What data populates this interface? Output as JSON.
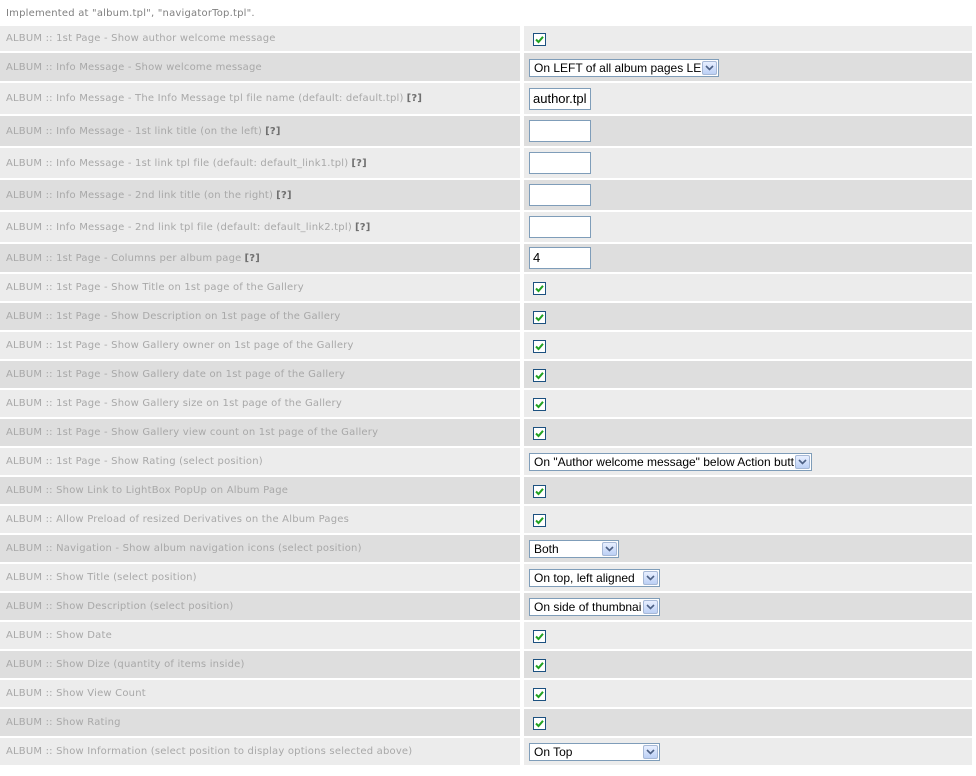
{
  "intro": "Implemented at \"album.tpl\", \"navigatorTop.tpl\".",
  "help_marker": "[?]",
  "rows": [
    {
      "label": "ALBUM :: 1st Page - Show author welcome message",
      "help": false,
      "control": "checkbox",
      "checked": true
    },
    {
      "label": "ALBUM :: Info Message - Show welcome message",
      "help": false,
      "control": "select",
      "value": "On LEFT of all album pages LEFT",
      "width": 190
    },
    {
      "label": "ALBUM :: Info Message - The Info Message tpl file name (default: default.tpl)",
      "help": true,
      "control": "text",
      "value": "author.tpl"
    },
    {
      "label": "ALBUM :: Info Message - 1st link title (on the left)",
      "help": true,
      "control": "text",
      "value": ""
    },
    {
      "label": "ALBUM :: Info Message - 1st link tpl file (default: default_link1.tpl)",
      "help": true,
      "control": "text",
      "value": ""
    },
    {
      "label": "ALBUM :: Info Message - 2nd link title (on the right)",
      "help": true,
      "control": "text",
      "value": ""
    },
    {
      "label": "ALBUM :: Info Message - 2nd link tpl file (default: default_link2.tpl)",
      "help": true,
      "control": "text",
      "value": ""
    },
    {
      "label": "ALBUM :: 1st Page - Columns per album page",
      "help": true,
      "control": "text",
      "value": "4"
    },
    {
      "label": "ALBUM :: 1st Page - Show Title on 1st page of the Gallery",
      "help": false,
      "control": "checkbox",
      "checked": true
    },
    {
      "label": "ALBUM :: 1st Page - Show Description on 1st page of the Gallery",
      "help": false,
      "control": "checkbox",
      "checked": true
    },
    {
      "label": "ALBUM :: 1st Page - Show Gallery owner on 1st page of the Gallery",
      "help": false,
      "control": "checkbox",
      "checked": true
    },
    {
      "label": "ALBUM :: 1st Page - Show Gallery date on 1st page of the Gallery",
      "help": false,
      "control": "checkbox",
      "checked": true
    },
    {
      "label": "ALBUM :: 1st Page - Show Gallery size on 1st page of the Gallery",
      "help": false,
      "control": "checkbox",
      "checked": true
    },
    {
      "label": "ALBUM :: 1st Page - Show Gallery view count on 1st page of the Gallery",
      "help": false,
      "control": "checkbox",
      "checked": true
    },
    {
      "label": "ALBUM :: 1st Page - Show Rating (select position)",
      "help": false,
      "control": "select",
      "value": "On \"Author welcome message\" below Action buttons)",
      "width": 283
    },
    {
      "label": "ALBUM :: Show Link to LightBox PopUp on Album Page",
      "help": false,
      "control": "checkbox",
      "checked": true
    },
    {
      "label": "ALBUM :: Allow Preload of resized Derivatives on the Album Pages",
      "help": false,
      "control": "checkbox",
      "checked": true
    },
    {
      "label": "ALBUM :: Navigation - Show album navigation icons (select position)",
      "help": false,
      "control": "select",
      "value": "Both",
      "width": 90
    },
    {
      "label": "ALBUM :: Show Title (select position)",
      "help": false,
      "control": "select",
      "value": "On top, left aligned",
      "width": 131
    },
    {
      "label": "ALBUM :: Show Description (select position)",
      "help": false,
      "control": "select",
      "value": "On side of thumbnails",
      "width": 131
    },
    {
      "label": "ALBUM :: Show Date",
      "help": false,
      "control": "checkbox",
      "checked": true
    },
    {
      "label": "ALBUM :: Show Dize (quantity of items inside)",
      "help": false,
      "control": "checkbox",
      "checked": true
    },
    {
      "label": "ALBUM :: Show View Count",
      "help": false,
      "control": "checkbox",
      "checked": true
    },
    {
      "label": "ALBUM :: Show Rating",
      "help": false,
      "control": "checkbox",
      "checked": true
    },
    {
      "label": "ALBUM :: Show Information (select position to display options selected above)",
      "help": false,
      "control": "select",
      "value": "On Top",
      "width": 131
    }
  ],
  "colors": {
    "row_light": "#ececec",
    "row_dark": "#dedede",
    "label_text": "#a8a8a8",
    "check_green": "#21a121",
    "check_border": "#1c5180"
  }
}
